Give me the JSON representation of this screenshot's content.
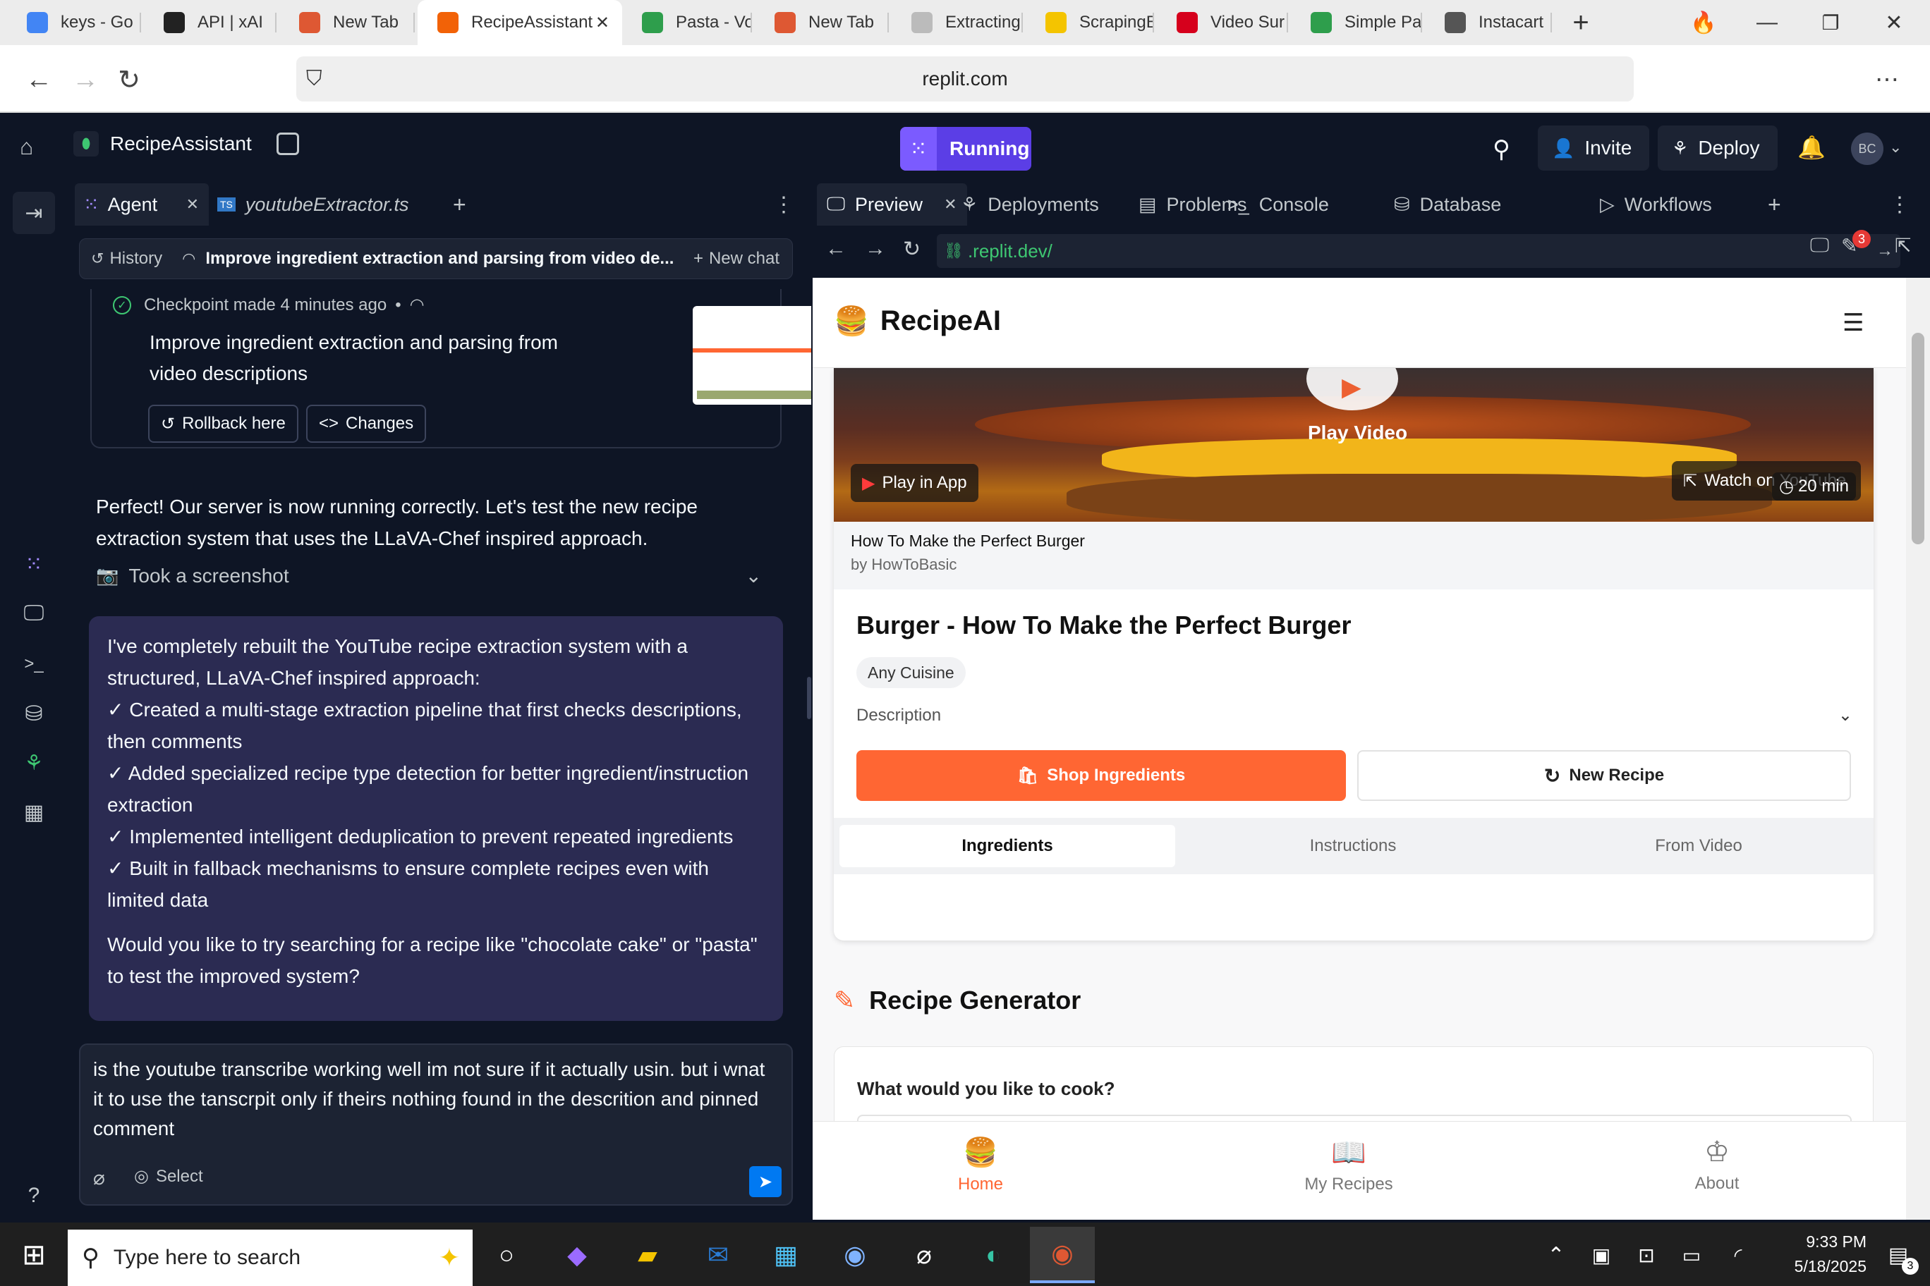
{
  "browser": {
    "tabs": [
      {
        "label": "keys - Go",
        "icon": "docs-icon",
        "color": "#4285f4"
      },
      {
        "label": "API | xAI",
        "icon": "xai-icon",
        "color": "#222222"
      },
      {
        "label": "New Tab",
        "icon": "duckduckgo-icon",
        "color": "#de5833"
      },
      {
        "label": "RecipeAssistant",
        "icon": "replit-icon",
        "color": "#f26207"
      },
      {
        "label": "Pasta - Vo",
        "icon": "carrot-icon",
        "color": "#2e9e4c"
      },
      {
        "label": "New Tab",
        "icon": "duckduckgo-icon",
        "color": "#de5833"
      },
      {
        "label": "Extracting",
        "icon": "loading-icon",
        "color": "#bbbbbb"
      },
      {
        "label": "ScrapingB",
        "icon": "scrapingbee-icon",
        "color": "#f4c400"
      },
      {
        "label": "Video Sur",
        "icon": "co-icon",
        "color": "#d6001c"
      },
      {
        "label": "Simple Pa",
        "icon": "carrot-icon",
        "color": "#2e9e4c"
      },
      {
        "label": "Instacart",
        "icon": "globe-icon",
        "color": "#555555"
      }
    ],
    "url": "replit.com"
  },
  "replit": {
    "project_name": "RecipeAssistant",
    "run_status": "Running",
    "invite": "Invite",
    "deploy": "Deploy",
    "avatar": "BC"
  },
  "agent": {
    "tab_agent": "Agent",
    "tab_file": "youtubeExtractor.ts",
    "history": "History",
    "chat_title": "Improve ingredient extraction and parsing from video de...",
    "new_chat": "New chat",
    "checkpoint_meta": "Checkpoint made 4 minutes ago",
    "checkpoint_dot": "•",
    "checkpoint_title": "Improve ingredient extraction and parsing from video descriptions",
    "rollback": "Rollback here",
    "changes": "Changes",
    "message1": "Perfect! Our server is now running correctly. Let's test the new recipe extraction system that uses the LLaVA-Chef inspired approach.",
    "screenshot_label": "Took a screenshot",
    "bubble_intro": "I've completely rebuilt the YouTube recipe extraction system with a structured, LLaVA-Chef inspired approach:",
    "bubble_points": [
      "✓ Created a multi-stage extraction pipeline that first checks descriptions, then comments",
      "✓ Added specialized recipe type detection for better ingredient/instruction extraction",
      "✓ Implemented intelligent deduplication to prevent repeated ingredients",
      "✓ Built in fallback mechanisms to ensure complete recipes even with limited data"
    ],
    "bubble_question": "Would you like to try searching for a recipe like \"chocolate cake\" or \"pasta\" to test the improved system?",
    "input_value": "is the youtube transcribe working well im not sure if it actually usin. but i wnat it to use the tanscrpit only if theirs nothing found in the descrition and pinned comment",
    "select": "Select"
  },
  "workspace": {
    "tabs": [
      "Preview",
      "Deployments",
      "Problems",
      "Console",
      "Database",
      "Workflows"
    ],
    "preview_url": ".replit.dev/",
    "badge_count": "3"
  },
  "app": {
    "brand": "RecipeAI",
    "play_video": "Play Video",
    "play_in_app": "Play in App",
    "watch_on": "Watch on YouTube",
    "duration": "20 min",
    "video_title": "How To Make the Perfect Burger",
    "video_author": "by HowToBasic",
    "recipe_title": "Burger - How To Make the Perfect Burger",
    "cuisine": "Any Cuisine",
    "description": "Description",
    "shop": "Shop Ingredients",
    "new_recipe": "New Recipe",
    "tabs": [
      "Ingredients",
      "Instructions",
      "From Video"
    ],
    "generator_title": "Recipe Generator",
    "generator_prompt": "What would you like to cook?",
    "nav": [
      "Home",
      "My Recipes",
      "About"
    ],
    "accent": "#ff6633"
  },
  "taskbar": {
    "search_placeholder": "Type here to search",
    "time": "9:33 PM",
    "date": "5/18/2025",
    "notif_count": "3"
  }
}
